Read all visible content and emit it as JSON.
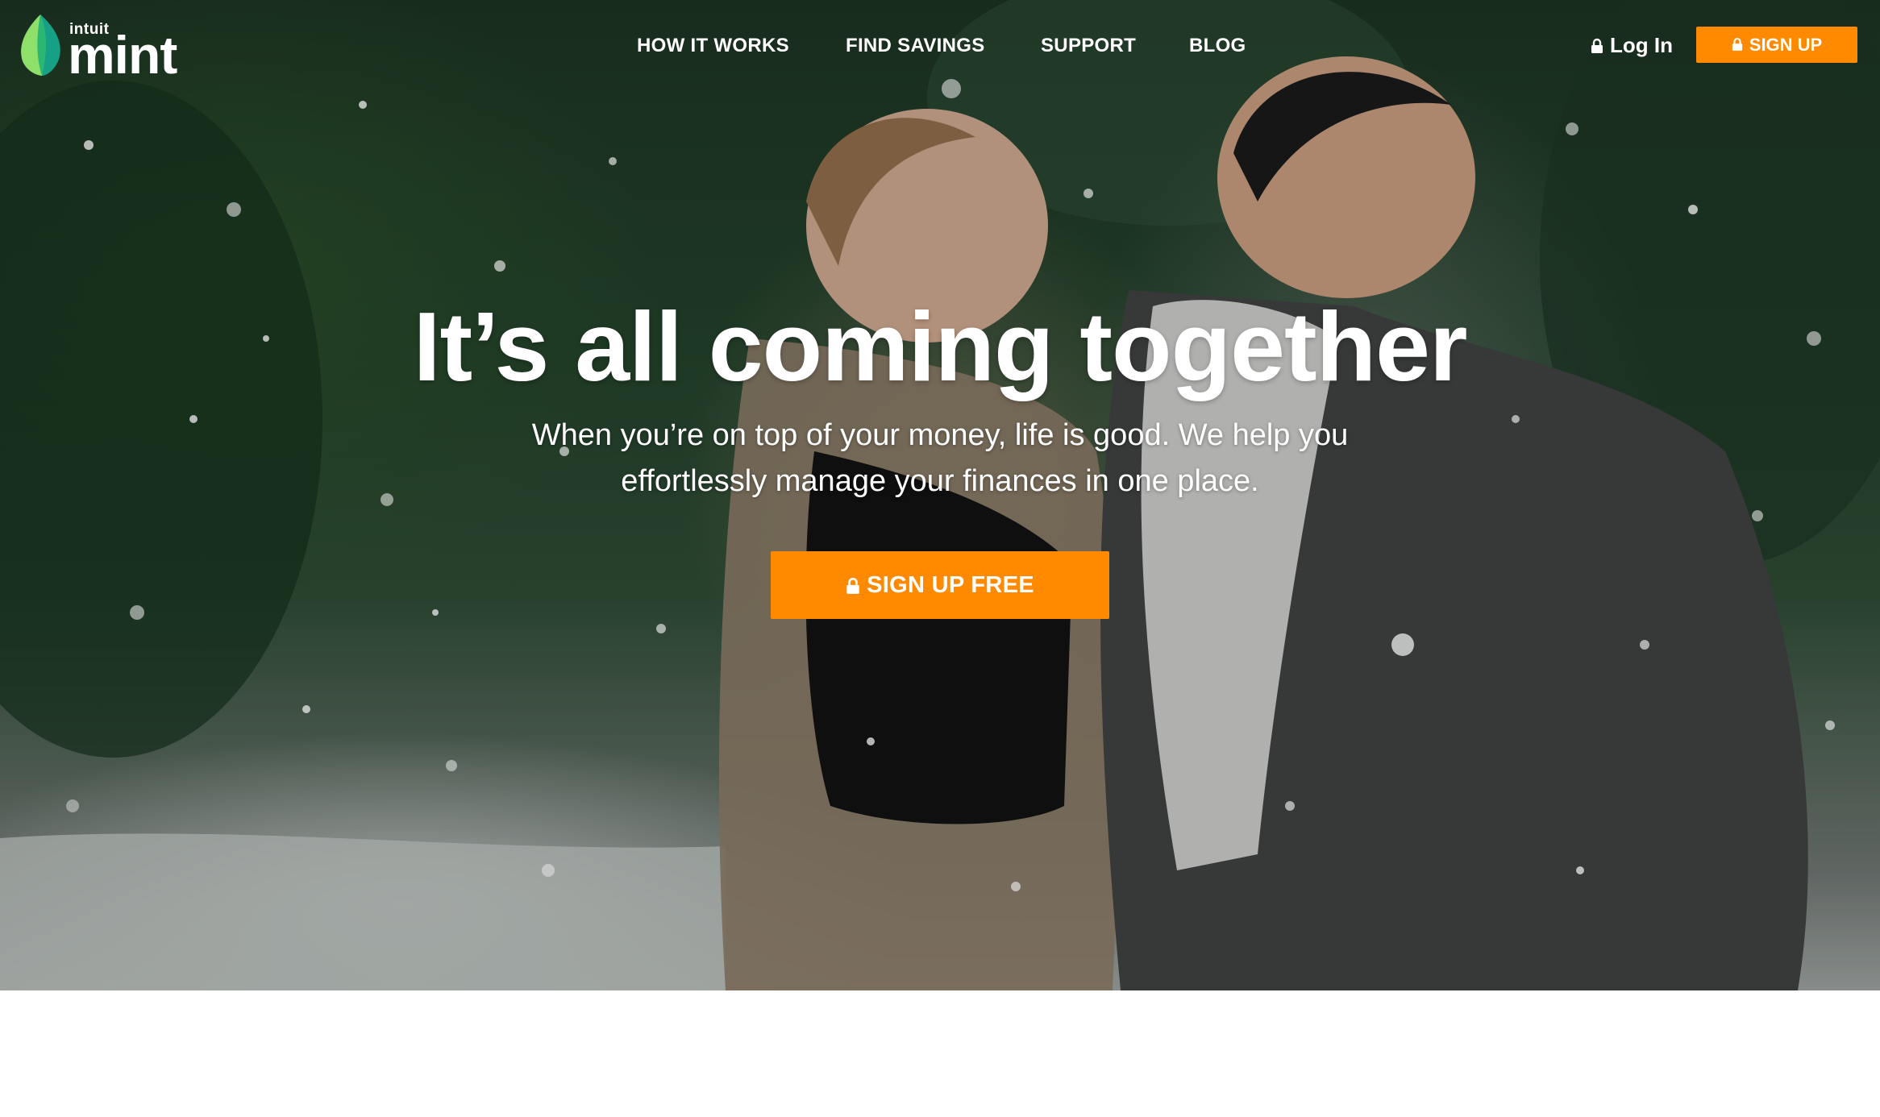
{
  "brand": {
    "company": "intuit",
    "product": "mint",
    "leaf_icon": "mint-leaf-icon",
    "colors": {
      "leaf_light": "#8ee06b",
      "leaf_mid": "#2bb673",
      "leaf_dark": "#16a085"
    }
  },
  "nav": {
    "links": [
      {
        "label": "HOW IT WORKS"
      },
      {
        "label": "FIND SAVINGS"
      },
      {
        "label": "SUPPORT"
      },
      {
        "label": "BLOG"
      }
    ],
    "login_label": "Log In",
    "signup_label": "SIGN UP",
    "lock_icon": "lock-icon"
  },
  "hero": {
    "headline": "It’s all coming together",
    "subline_1": "When you’re on top of your money, life is good. We help you",
    "subline_2": "effortlessly manage your finances in one place.",
    "cta_label": "SIGN UP FREE",
    "background": "couple-in-snow-photo"
  },
  "colors": {
    "accent": "#ff8a00",
    "text_on_hero": "#ffffff"
  }
}
